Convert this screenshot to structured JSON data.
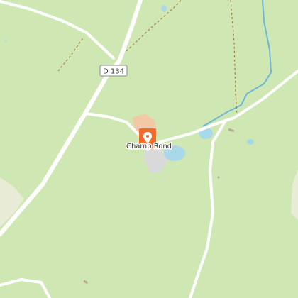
{
  "map": {
    "road_shield": {
      "text": "D 134"
    },
    "place_label": {
      "text": "Champ Rond"
    },
    "marker": {
      "icon": "location-pin-icon",
      "color": "#f26b2b"
    },
    "colors": {
      "land": "#cfe8b3",
      "forest": "#c8e3a9",
      "road": "#ffffff",
      "water": "#a8d8ea",
      "stream": "#6fb6d8",
      "track": "#b07a3a",
      "urban": "#f2c9a6",
      "built": "#d9d9d9"
    }
  }
}
